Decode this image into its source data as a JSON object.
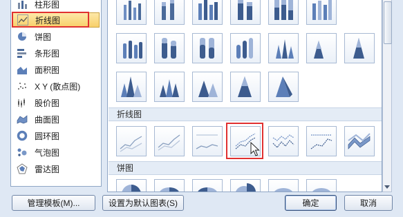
{
  "sidebar": {
    "items": [
      {
        "label": "柱形图",
        "icon": "column-chart-icon"
      },
      {
        "label": "折线图",
        "icon": "line-chart-icon"
      },
      {
        "label": "饼图",
        "icon": "pie-chart-icon"
      },
      {
        "label": "条形图",
        "icon": "bar-chart-icon"
      },
      {
        "label": "面积图",
        "icon": "area-chart-icon"
      },
      {
        "label": "X Y (散点图)",
        "icon": "scatter-chart-icon"
      },
      {
        "label": "股价图",
        "icon": "stock-chart-icon"
      },
      {
        "label": "曲面图",
        "icon": "surface-chart-icon"
      },
      {
        "label": "圆环图",
        "icon": "doughnut-chart-icon"
      },
      {
        "label": "气泡图",
        "icon": "bubble-chart-icon"
      },
      {
        "label": "雷达图",
        "icon": "radar-chart-icon"
      }
    ],
    "selected_index": 1
  },
  "gallery": {
    "sections": {
      "line": "折线图",
      "pie": "饼图"
    }
  },
  "buttons": {
    "manage_templates": "管理模板(M)...",
    "set_default": "设置为默认图表(S)",
    "ok": "确定",
    "cancel": "取消"
  },
  "colors": {
    "selection_border": "#e03030",
    "accent_blue": "#3f6fb5"
  }
}
